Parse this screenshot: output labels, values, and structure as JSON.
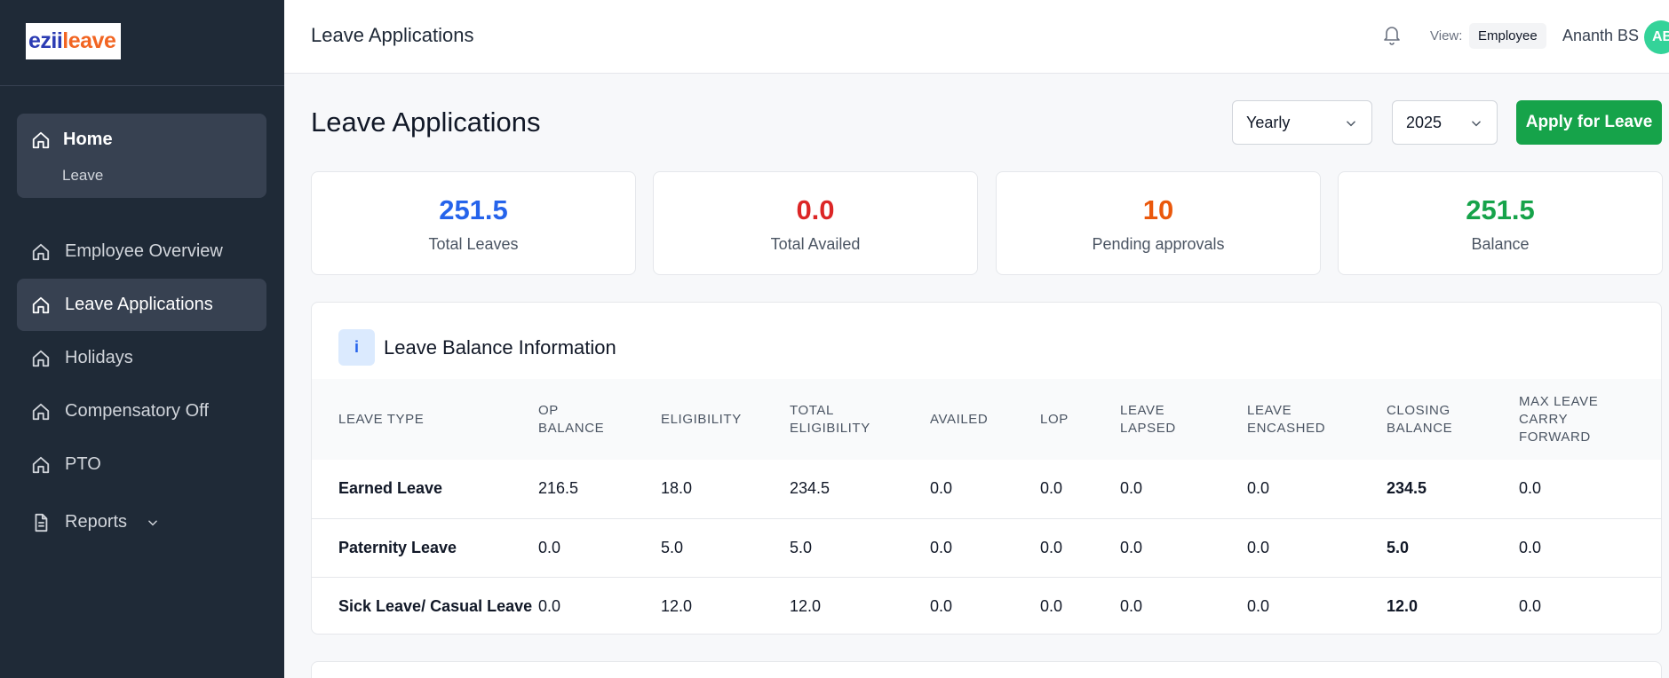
{
  "brand": {
    "part1": "ezii",
    "part2": "leave"
  },
  "sidebar": {
    "home": {
      "label": "Home",
      "sub_label": "Leave",
      "icon": "home-icon"
    },
    "items": [
      {
        "label": "Employee Overview",
        "icon": "home-icon",
        "active": false
      },
      {
        "label": "Leave Applications",
        "icon": "home-icon",
        "active": true
      },
      {
        "label": "Holidays",
        "icon": "home-icon",
        "active": false
      },
      {
        "label": "Compensatory Off",
        "icon": "home-icon",
        "active": false
      },
      {
        "label": "PTO",
        "icon": "home-icon",
        "active": false
      },
      {
        "label": "Reports",
        "icon": "document-icon",
        "active": false
      }
    ]
  },
  "topbar": {
    "title": "Leave Applications",
    "view_label": "View:",
    "view_value": "Employee",
    "user_name": "Ananth BS",
    "avatar_initials": "AB"
  },
  "page": {
    "title": "Leave Applications",
    "period_select": "Yearly",
    "year_select": "2025",
    "apply_button": "Apply for Leave"
  },
  "stats": [
    {
      "value": "251.5",
      "label": "Total Leaves",
      "color": "#2563eb"
    },
    {
      "value": "0.0",
      "label": "Total Availed",
      "color": "#dc2626"
    },
    {
      "value": "10",
      "label": "Pending approvals",
      "color": "#ea580c"
    },
    {
      "value": "251.5",
      "label": "Balance",
      "color": "#16a34a"
    }
  ],
  "balance": {
    "info_icon_text": "i",
    "title": "Leave Balance Information",
    "columns": [
      [
        "LEAVE TYPE"
      ],
      [
        "OP",
        "BALANCE"
      ],
      [
        "ELIGIBILITY"
      ],
      [
        "TOTAL",
        "ELIGIBILITY"
      ],
      [
        "AVAILED"
      ],
      [
        "LOP"
      ],
      [
        "LEAVE",
        "LAPSED"
      ],
      [
        "LEAVE",
        "ENCASHED"
      ],
      [
        "CLOSING",
        "BALANCE"
      ],
      [
        "MAX LEAVE",
        "CARRY",
        "FORWARD"
      ]
    ],
    "rows": [
      [
        "Earned Leave",
        "216.5",
        "18.0",
        "234.5",
        "0.0",
        "0.0",
        "0.0",
        "0.0",
        "234.5",
        "0.0"
      ],
      [
        "Paternity Leave",
        "0.0",
        "5.0",
        "5.0",
        "0.0",
        "0.0",
        "0.0",
        "0.0",
        "5.0",
        "0.0"
      ],
      [
        "Sick Leave/ Casual Leave",
        "0.0",
        "12.0",
        "12.0",
        "0.0",
        "0.0",
        "0.0",
        "0.0",
        "12.0",
        "0.0"
      ]
    ]
  }
}
